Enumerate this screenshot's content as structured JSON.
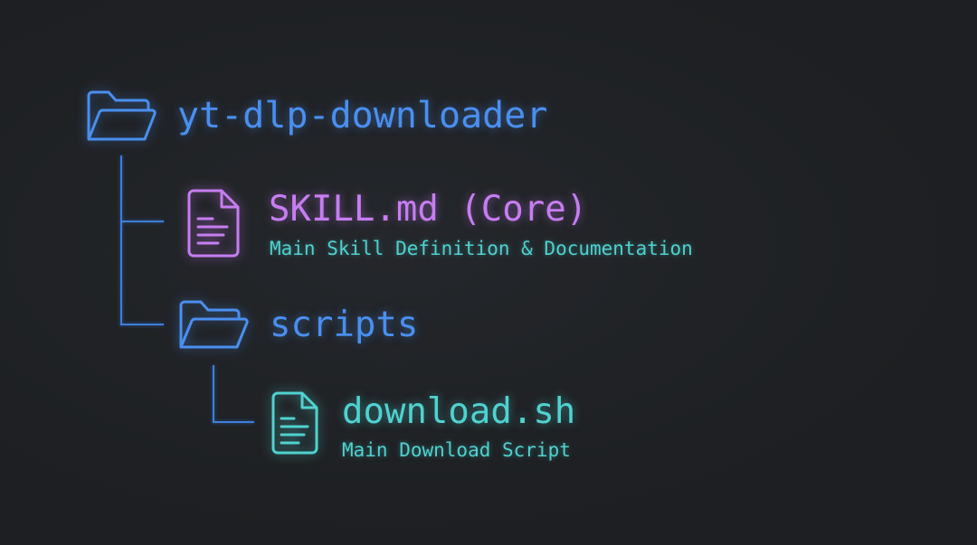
{
  "tree": {
    "root": {
      "label": "yt-dlp-downloader",
      "icon": "folder-open-icon",
      "color": "#4a8ff0"
    },
    "children": [
      {
        "label": "SKILL.md (Core)",
        "description": "Main Skill Definition & Documentation",
        "icon": "file-text-icon",
        "color": "#c77df2"
      },
      {
        "label": "scripts",
        "icon": "folder-open-icon",
        "color": "#4a8ff0",
        "children": [
          {
            "label": "download.sh",
            "description": "Main Download Script",
            "icon": "file-text-icon",
            "color": "#4fd2d0"
          }
        ]
      }
    ]
  }
}
